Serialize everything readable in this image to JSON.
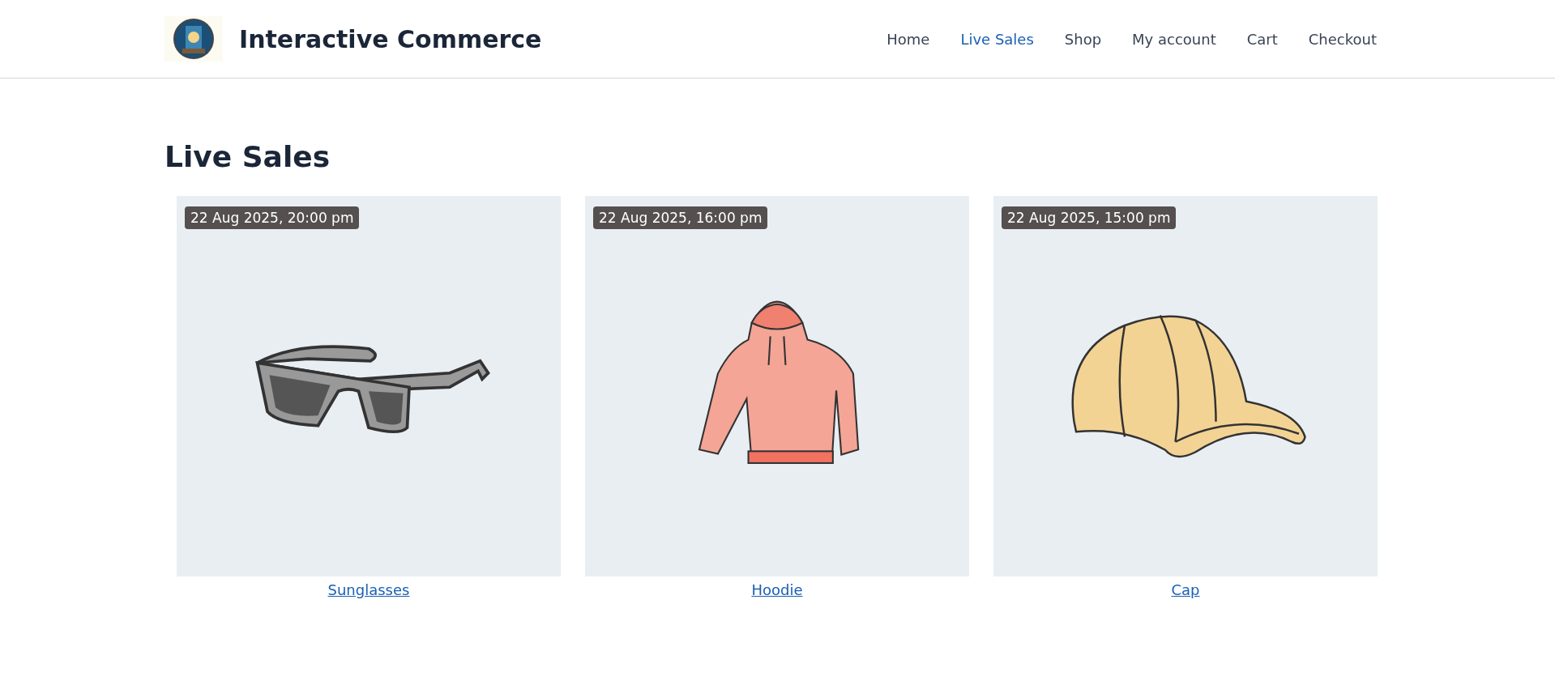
{
  "site": {
    "title": "Interactive Commerce"
  },
  "nav": [
    {
      "label": "Home",
      "selected": false
    },
    {
      "label": "Live Sales",
      "selected": true
    },
    {
      "label": "Shop",
      "selected": false
    },
    {
      "label": "My account",
      "selected": false
    },
    {
      "label": "Cart",
      "selected": false
    },
    {
      "label": "Checkout",
      "selected": false
    }
  ],
  "heading": "Live Sales",
  "products": [
    {
      "kind": "sunglasses",
      "date": "22 Aug 2025, 20:00 pm",
      "name": "Sunglasses"
    },
    {
      "kind": "hoodie",
      "date": "22 Aug 2025, 16:00 pm",
      "name": "Hoodie"
    },
    {
      "kind": "cap",
      "date": "22 Aug 2025, 15:00 pm",
      "name": "Cap"
    }
  ]
}
